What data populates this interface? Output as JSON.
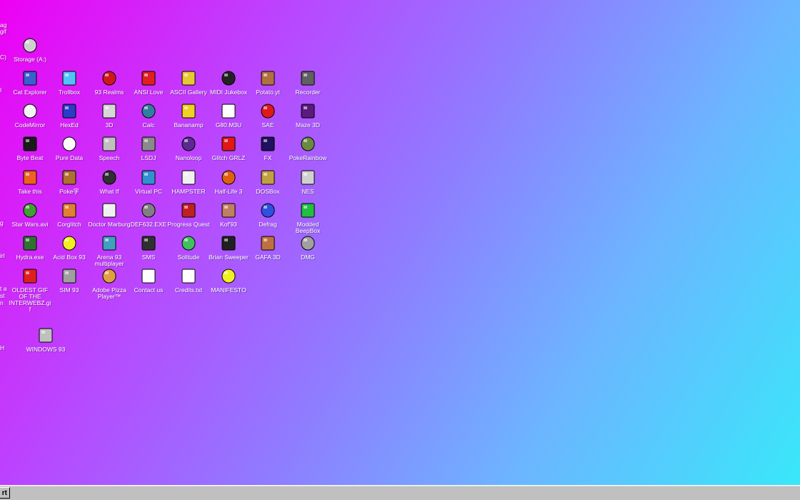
{
  "desktop": {
    "edge_labels": [
      "ag",
      "gif",
      "C)",
      "I",
      "g",
      "irl",
      "t a",
      "st",
      "n",
      "H"
    ],
    "icons": [
      {
        "label": "Storage (A:)",
        "icon": "floppy-drive-icon",
        "color": "#d0d0d0"
      },
      {
        "label": "Cat Explorer",
        "icon": "cat-globe-icon",
        "color": "#3a5fd0"
      },
      {
        "label": "Trollbox",
        "icon": "chat-bubbles-icon",
        "color": "#4fc3f7"
      },
      {
        "label": "93 Realms",
        "icon": "red-creature-icon",
        "color": "#d01818"
      },
      {
        "label": "ANSI Love",
        "icon": "letter-a-icon",
        "color": "#e02020"
      },
      {
        "label": "ASCII Gallery",
        "icon": "numbers-123-icon",
        "color": "#e8c830"
      },
      {
        "label": "MIDI Jukebox",
        "icon": "piano-keys-icon",
        "color": "#222222"
      },
      {
        "label": "Potato.yt",
        "icon": "potato-icon",
        "color": "#b07040"
      },
      {
        "label": "Recorder",
        "icon": "microphone-icon",
        "color": "#606060"
      },
      {
        "label": "CodeMirror",
        "icon": "lamb-icon",
        "color": "#f4f4f4"
      },
      {
        "label": "HexEd",
        "icon": "hexagon-cube-icon",
        "color": "#2a3cc8"
      },
      {
        "label": "3D",
        "icon": "teapot-icon",
        "color": "#d8d8d8"
      },
      {
        "label": "Calc",
        "icon": "calculator-icon",
        "color": "#2f7fa0"
      },
      {
        "label": "Bananamp",
        "icon": "banana-icon",
        "color": "#f0d020"
      },
      {
        "label": "G80.M3U",
        "icon": "music-file-icon",
        "color": "#ffffff"
      },
      {
        "label": "SAE",
        "icon": "checkered-ball-icon",
        "color": "#e01818"
      },
      {
        "label": "Maze 3D",
        "icon": "maze-icon",
        "color": "#5a1a80"
      },
      {
        "label": "Byte Beat",
        "icon": "waveform-icon",
        "color": "#1a1a1a"
      },
      {
        "label": "Pure Data",
        "icon": "pd-icon",
        "color": "#ffffff"
      },
      {
        "label": "Speech",
        "icon": "speaker-face-icon",
        "color": "#c0c0c0"
      },
      {
        "label": "LSDJ",
        "icon": "gameboy-icon",
        "color": "#8a8a8a"
      },
      {
        "label": "Nanoloop",
        "icon": "diamond-wave-icon",
        "color": "#5a2a90"
      },
      {
        "label": "Glitch GRLZ",
        "icon": "lips-icon",
        "color": "#e01818"
      },
      {
        "label": "FX",
        "icon": "star-fx-icon",
        "color": "#201060"
      },
      {
        "label": "PokeRainbow",
        "icon": "pixel-people-icon",
        "color": "#6a8a40"
      },
      {
        "label": "Take this",
        "icon": "orange-creature-icon",
        "color": "#f06020"
      },
      {
        "label": "Poke字",
        "icon": "small-monster-icon",
        "color": "#b07030"
      },
      {
        "label": "What If",
        "icon": "grid-window-icon",
        "color": "#303030"
      },
      {
        "label": "Virtual PC",
        "icon": "pc-window-icon",
        "color": "#3090d0"
      },
      {
        "label": "HAMPSTER",
        "icon": "hamster-icon",
        "color": "#f0f0f0"
      },
      {
        "label": "Half-Life 3",
        "icon": "lambda-icon",
        "color": "#e06010"
      },
      {
        "label": "DOSBox",
        "icon": "dos-box-icon",
        "color": "#c0a040"
      },
      {
        "label": "NES",
        "icon": "nes-console-icon",
        "color": "#d0d0d0"
      },
      {
        "label": "Star Wars.avi",
        "icon": "yoda-icon",
        "color": "#40a030"
      },
      {
        "label": "Corglitch",
        "icon": "corgi-icon",
        "color": "#e08030"
      },
      {
        "label": "Doctor Marburg",
        "icon": "doctor-icon",
        "color": "#f0f0f0"
      },
      {
        "label": "DEF632.EXE",
        "icon": "terminal-icon",
        "color": "#808080"
      },
      {
        "label": "Progress Quest",
        "icon": "crossed-swords-icon",
        "color": "#c02020"
      },
      {
        "label": "Kof'93",
        "icon": "fighter-portrait-icon",
        "color": "#c08060"
      },
      {
        "label": "Defrag",
        "icon": "defrag-blocks-icon",
        "color": "#3050e0"
      },
      {
        "label": "Modded BeepBox",
        "icon": "green-ring-icon",
        "color": "#20c040"
      },
      {
        "label": "Hydra.exe",
        "icon": "hydra-icon",
        "color": "#307030"
      },
      {
        "label": "Acid Box 93",
        "icon": "smiley-icon",
        "color": "#f0f020"
      },
      {
        "label": "Arena 93 multiplayer",
        "icon": "cube-icon",
        "color": "#40a0c0"
      },
      {
        "label": "SMS",
        "icon": "console-icon",
        "color": "#303030"
      },
      {
        "label": "Solitude",
        "icon": "bottle-icon",
        "color": "#40c060"
      },
      {
        "label": "Brian Sweeper",
        "icon": "mine-icon",
        "color": "#202020"
      },
      {
        "label": "GAFA 3D",
        "icon": "face-portrait-icon",
        "color": "#c07040"
      },
      {
        "label": "DMG",
        "icon": "disk-drive-icon",
        "color": "#a0a0a0"
      },
      {
        "label": "OLDEST GIF OF THE INTERWEBZ.gif",
        "icon": "gif-file-icon",
        "color": "#e02020"
      },
      {
        "label": "SIM 93",
        "icon": "book-icon",
        "color": "#a0a0a0"
      },
      {
        "label": "Adobe Pizza Player™",
        "icon": "pizza-icon",
        "color": "#e0a040"
      },
      {
        "label": "Contact us",
        "icon": "mail-icon",
        "color": "#ffffff"
      },
      {
        "label": "Credits.txt",
        "icon": "text-file-icon",
        "color": "#ffffff"
      },
      {
        "label": "MANIFESTO",
        "icon": "question-mark-icon",
        "color": "#f0f020"
      },
      {
        "label": "WINDOWS 93",
        "icon": "computer-icon",
        "color": "#c0c0c0"
      }
    ]
  },
  "taskbar": {
    "start_label": "rt"
  }
}
